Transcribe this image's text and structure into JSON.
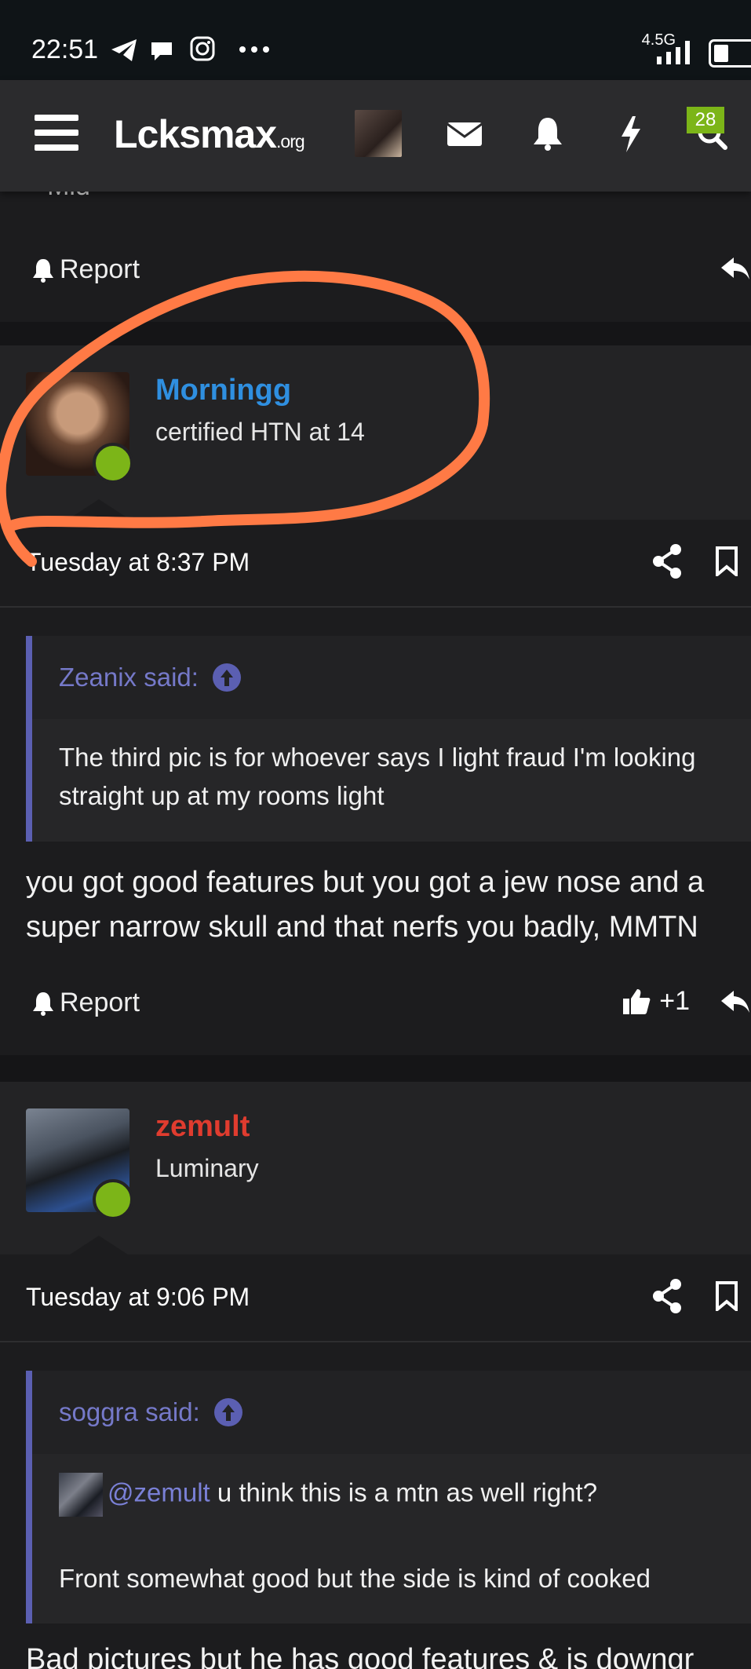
{
  "status_bar": {
    "time": "22:51",
    "icons": [
      "telegram-icon",
      "chat-bubble-icon",
      "instagram-icon",
      "more-icon"
    ],
    "network": "4.5G",
    "battery_level": 0.3
  },
  "nav": {
    "logo_main": "Lcksmax",
    "logo_suffix": ".org",
    "notification_count": "28",
    "icons": [
      "menu-icon",
      "user-avatar",
      "mail-icon",
      "bell-icon",
      "bolt-icon",
      "search-icon"
    ]
  },
  "prev_post": {
    "cut_text": "\"Mid",
    "report_label": "Report"
  },
  "posts": [
    {
      "username": "Morningg",
      "username_color": "#2f8fe0",
      "user_title": "certified HTN at 14",
      "date": "Tuesday at 8:37 PM",
      "quote_author": "Zeanix said:",
      "quote_lines": [
        "The third pic is for whoever says I light fraud I'm looking",
        "straight up at my rooms light"
      ],
      "message_lines": [
        "you got good features but you got a jew nose and a",
        "super narrow skull and that nerfs you badly, MMTN"
      ],
      "report_label": "Report",
      "reaction_count": "+1"
    },
    {
      "username": "zemult",
      "username_color": "#e03c2f",
      "user_title": "Luminary",
      "date": "Tuesday at 9:06 PM",
      "quote_author": "soggra said:",
      "quote_mention": "@zemult",
      "quote_line_1": " u think this is a mtn as well right?",
      "quote_line_2": "Front somewhat good but the side is kind of cooked",
      "message_line": "Bad pictures but he has good features & is downgr"
    }
  ],
  "colors": {
    "accent_online": "#7cb518",
    "quote_border": "#5b5fb2",
    "annotation": "#ff7a45"
  }
}
